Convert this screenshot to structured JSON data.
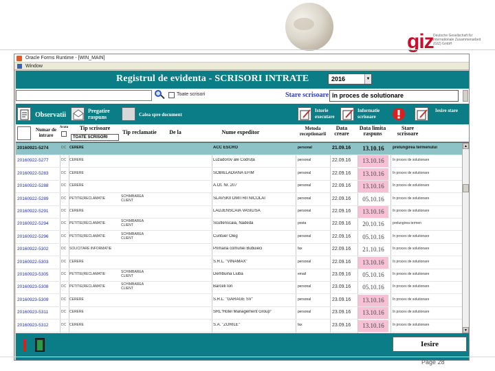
{
  "branding": {
    "logo_text": "giz",
    "logo_subtext": "Deutsche Gesellschaft für Internationale Zusammenarbeit (GIZ) GmbH"
  },
  "window": {
    "title": "Oracle Forms Runtime - [WIN_MAIN]",
    "menu": "Window"
  },
  "form": {
    "title": "Registrul de evidenta - SCRISORI  INTRATE",
    "year": "2016",
    "search_value": "",
    "checkbox_label": "Toate scrisori",
    "stare_label": "Stare scrisoare",
    "stare_value": "în proces de solutionare"
  },
  "toolbar": {
    "observatii": "Observatii",
    "pregatire": "Pregatire raspuns",
    "calea": "Calea spre document",
    "istorie": "Istorie executare",
    "informatie": "Informatie scrisoare",
    "iesire_stare": "Iesire stare"
  },
  "columns": {
    "numar": "Numar de intrare",
    "arata": "Arata",
    "tip_scrisoare": "Tip scrisoare",
    "tip_filter": "TOATE SCRISORI",
    "tip_reclamatie": "Tip reclamatie",
    "de_la": "De la",
    "nume_expeditor": "Nume expeditor",
    "metoda": "Metoda receptionarii",
    "data_creare": "Data creare",
    "data_limita": "Data limita raspuns",
    "stare": "Stare scrisoare"
  },
  "rows": [
    {
      "nr": "20160921-5274",
      "ind": "DC",
      "tip": "CERERE",
      "tr": "",
      "exp": "ACC ESCRO",
      "met": "personal",
      "dc": "21.09.16",
      "dl": "13.10.16",
      "pink": false,
      "st": "prelungirea termenului"
    },
    {
      "nr": "20160922-5277",
      "ind": "DC",
      "tip": "CERERE",
      "tr": "",
      "exp": "Luzadorov ale Codruța",
      "met": "personal",
      "dc": "22.09.16",
      "dl": "13.10.16",
      "pink": true,
      "st": "în proces de solutionare"
    },
    {
      "nr": "20160922-5283",
      "ind": "DC",
      "tip": "CERERE",
      "tr": "",
      "exp": "SOBIELADIANA EFIM",
      "met": "personal",
      "dc": "22.09.16",
      "dl": "13.10.16",
      "pink": true,
      "st": "în proces de solutionare"
    },
    {
      "nr": "20160922-5288",
      "ind": "DC",
      "tip": "CERERE",
      "tr": "",
      "exp": "A.Ot. Nr. 207",
      "met": "personal",
      "dc": "22.09.16",
      "dl": "13.10.16",
      "pink": true,
      "st": "în proces de solutionare"
    },
    {
      "nr": "20160922-5289",
      "ind": "DC",
      "tip": "PETITIE(RECLAMATIE",
      "tr": "SCHIMBAREA CLIENT",
      "exp": "SLAVSKII DMITRII NICOLAI",
      "met": "personal",
      "dc": "22.09.16",
      "dl": "05.10.16",
      "pink": false,
      "st": "în proces de solutionare"
    },
    {
      "nr": "20160922-5291",
      "ind": "DC",
      "tip": "CERERE",
      "tr": "",
      "exp": "LADJENSCAIA  VASILISA",
      "met": "personal",
      "dc": "22.09.16",
      "dl": "13.10.16",
      "pink": true,
      "st": "în proces de solutionare"
    },
    {
      "nr": "20160922-5294",
      "ind": "DC",
      "tip": "PETITIE(RECLAMATIE",
      "tr": "SCHIMBAREA CLIENT",
      "exp": "Scutlenscaia, Nadeda",
      "met": "posta",
      "dc": "22.09.16",
      "dl": "20.10.16",
      "pink": false,
      "st": "prelungirea termen"
    },
    {
      "nr": "20160922-5296",
      "ind": "DC",
      "tip": "PETITIE(RECLAMATIE",
      "tr": "SCHIMBAREA CLIENT",
      "exp": "Cuntuer Oleg",
      "met": "personal",
      "dc": "22.09.16",
      "dl": "05.10.16",
      "pink": false,
      "st": "în proces de solutionare"
    },
    {
      "nr": "20160922-5302",
      "ind": "DC",
      "tip": "SOLICITARE INFORMATIE",
      "tr": "",
      "exp": "Primaria comunei Bubuieci",
      "met": "fax",
      "dc": "22.09.16",
      "dl": "21.10.16",
      "pink": false,
      "st": "în proces de solutionare"
    },
    {
      "nr": "20160922-5303",
      "ind": "DC",
      "tip": "CERERE",
      "tr": "",
      "exp": "S.R.L. \"VINAMAX\"",
      "met": "personal",
      "dc": "22.09.16",
      "dl": "13.10.16",
      "pink": true,
      "st": "în proces de solutionare"
    },
    {
      "nr": "20160923-5305",
      "ind": "DC",
      "tip": "PETITIE(RECLAMATIE",
      "tr": "SCHIMBAREA CLIENT",
      "exp": "Dembuina Liuba",
      "met": "email",
      "dc": "23.09.16",
      "dl": "05.10.16",
      "pink": false,
      "st": "în proces de solutionare"
    },
    {
      "nr": "20160923-5308",
      "ind": "DC",
      "tip": "PETITIE(RECLAMATIE",
      "tr": "SCHIMBAREA CLIENT",
      "exp": "Barceli Ion",
      "met": "personal",
      "dc": "23.09.16",
      "dl": "05.10.16",
      "pink": false,
      "st": "în proces de solutionare"
    },
    {
      "nr": "20160923-5309",
      "ind": "DC",
      "tip": "CERERE",
      "tr": "",
      "exp": "S.R.L. \"GARAGE SV\"",
      "met": "personal",
      "dc": "23.09.16",
      "dl": "13.10.16",
      "pink": true,
      "st": "în proces de solutionare"
    },
    {
      "nr": "20160923-5311",
      "ind": "DC",
      "tip": "CERERE",
      "tr": "",
      "exp": "SRL\"Hotel Management Group\"",
      "met": "personal",
      "dc": "23.09.16",
      "dl": "13.10.16",
      "pink": true,
      "st": "în proces de solutionare"
    },
    {
      "nr": "20160923-5312",
      "ind": "DC",
      "tip": "CERERE",
      "tr": "",
      "exp": "S.A. \"ZORILE\"",
      "met": "fax",
      "dc": "23.09.16",
      "dl": "13.10.16",
      "pink": true,
      "st": "în proces de solutionare"
    }
  ],
  "footer": {
    "iesire": "Iesire"
  },
  "page": {
    "number": "Page 28"
  },
  "colors": {
    "teal": "#0a7d86",
    "pink": "#f6c1d4",
    "selected": "#8dc3c6",
    "title_blue": "#2a3fb0"
  }
}
